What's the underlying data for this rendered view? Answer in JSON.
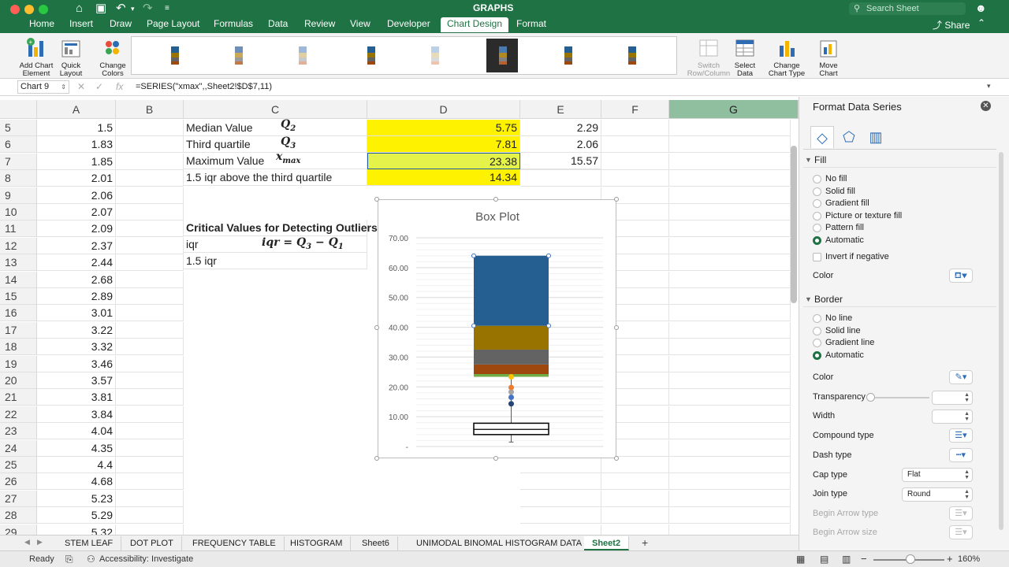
{
  "window": {
    "title": "GRAPHS",
    "search_placeholder": "Search Sheet",
    "share_label": "Share",
    "ribbon_tabs": [
      {
        "label": "Home"
      },
      {
        "label": "Insert"
      },
      {
        "label": "Draw"
      },
      {
        "label": "Page Layout"
      },
      {
        "label": "Formulas"
      },
      {
        "label": "Data"
      },
      {
        "label": "Review"
      },
      {
        "label": "View"
      },
      {
        "label": "Developer"
      },
      {
        "label": "Chart Design"
      },
      {
        "label": "Format"
      }
    ],
    "active_tab": "Chart Design"
  },
  "ribbon": {
    "add_chart_element": "Add Chart Element",
    "quick_layout": "Quick Layout",
    "change_colors": "Change Colors",
    "switch_row_column": "Switch Row/Column",
    "select_data": "Select Data",
    "change_chart_type": "Change Chart Type",
    "move_chart": "Move Chart"
  },
  "formula_bar": {
    "name_box": "Chart 9",
    "fx": "fx",
    "formula": "=SERIES(\"xmax\",,Sheet2!$D$7,11)"
  },
  "columns": [
    "A",
    "B",
    "C",
    "D",
    "E",
    "F",
    "G"
  ],
  "rows": [
    {
      "n": "5",
      "a": "1.5"
    },
    {
      "n": "6",
      "a": "1.83"
    },
    {
      "n": "7",
      "a": "1.85"
    },
    {
      "n": "8",
      "a": "2.01"
    },
    {
      "n": "9",
      "a": "2.06"
    },
    {
      "n": "10",
      "a": "2.07"
    },
    {
      "n": "11",
      "a": "2.09"
    },
    {
      "n": "12",
      "a": "2.37"
    },
    {
      "n": "13",
      "a": "2.44"
    },
    {
      "n": "14",
      "a": "2.68"
    },
    {
      "n": "15",
      "a": "2.89"
    },
    {
      "n": "16",
      "a": "3.01"
    },
    {
      "n": "17",
      "a": "3.22"
    },
    {
      "n": "18",
      "a": "3.32"
    },
    {
      "n": "19",
      "a": "3.46"
    },
    {
      "n": "20",
      "a": "3.57"
    },
    {
      "n": "21",
      "a": "3.81"
    },
    {
      "n": "22",
      "a": "3.84"
    },
    {
      "n": "23",
      "a": "4.04"
    },
    {
      "n": "24",
      "a": "4.35"
    },
    {
      "n": "25",
      "a": "4.4"
    },
    {
      "n": "26",
      "a": "4.68"
    },
    {
      "n": "27",
      "a": "5.23"
    },
    {
      "n": "28",
      "a": "5.29"
    },
    {
      "n": "29",
      "a": "5.32"
    }
  ],
  "cells": {
    "c5": "Median Value",
    "d5": "5.75",
    "e5": "2.29",
    "c6": "Third quartile",
    "d6": "7.81",
    "e6": "2.06",
    "c7": "Maximum Value",
    "d7": "23.38",
    "e7": "15.57",
    "c8": "1.5 iqr above the third quartile",
    "d8": "14.34",
    "c11": "Critical Values for Detecting Outliers",
    "c12": "iqr",
    "c13": "1.5 iqr"
  },
  "math": {
    "q2": "Q",
    "q2_sub": "2",
    "q3": "Q",
    "q3_sub": "3",
    "xmax": "x",
    "xmax_sub": "max",
    "iqr_formula": "iqr = Q",
    "iqr_sub3": "3",
    "iqr_minus": " − Q",
    "iqr_sub1": "1"
  },
  "chart_data": {
    "type": "bar",
    "title": "Box Plot",
    "ylim": [
      0,
      70
    ],
    "yticks": [
      "70.00",
      "60.00",
      "50.00",
      "40.00",
      "30.00",
      "20.00",
      "10.00",
      "-"
    ],
    "stacked_segments": [
      {
        "from": 23.38,
        "to": 24.3,
        "color": "#70ad47"
      },
      {
        "from": 24.3,
        "to": 27.5,
        "color": "#9e480e"
      },
      {
        "from": 27.5,
        "to": 32.5,
        "color": "#636363"
      },
      {
        "from": 32.5,
        "to": 40.5,
        "color": "#997300"
      },
      {
        "from": 40.5,
        "to": 64.0,
        "color": "#255e91"
      }
    ],
    "box": {
      "q1": 4.0,
      "q3": 7.81,
      "whisker_low": 1.5
    },
    "points": [
      {
        "y": 14.34,
        "color": "#264478"
      },
      {
        "y": 16.5,
        "color": "#4472c4"
      },
      {
        "y": 18.3,
        "color": "#a5a5a5"
      },
      {
        "y": 19.8,
        "color": "#ed7d31"
      },
      {
        "y": 23.38,
        "color": "#ffc000"
      }
    ]
  },
  "sheet_tabs": [
    {
      "label": "STEM LEAF"
    },
    {
      "label": "DOT PLOT"
    },
    {
      "label": "FREQUENCY TABLE"
    },
    {
      "label": "HISTOGRAM"
    },
    {
      "label": "Sheet6"
    },
    {
      "label": "UNIMODAL BINOMAL HISTOGRAM DATA"
    },
    {
      "label": "Sheet2"
    }
  ],
  "active_sheet": "Sheet2",
  "status": {
    "ready": "Ready",
    "accessibility": "Accessibility: Investigate",
    "zoom": "160%"
  },
  "pane": {
    "title": "Format Data Series",
    "fill_header": "Fill",
    "fill_options": [
      {
        "label": "No fill",
        "on": false
      },
      {
        "label": "Solid fill",
        "on": false
      },
      {
        "label": "Gradient fill",
        "on": false
      },
      {
        "label": "Picture or texture fill",
        "on": false
      },
      {
        "label": "Pattern fill",
        "on": false
      },
      {
        "label": "Automatic",
        "on": true
      }
    ],
    "invert_if_negative": "Invert if negative",
    "color_label": "Color",
    "border_header": "Border",
    "border_options": [
      {
        "label": "No line",
        "on": false
      },
      {
        "label": "Solid line",
        "on": false
      },
      {
        "label": "Gradient line",
        "on": false
      },
      {
        "label": "Automatic",
        "on": true
      }
    ],
    "border_color_label": "Color",
    "transparency_label": "Transparency",
    "width_label": "Width",
    "compound_label": "Compound type",
    "dash_label": "Dash type",
    "cap_label": "Cap type",
    "cap_value": "Flat",
    "join_label": "Join type",
    "join_value": "Round",
    "begin_arrow_type": "Begin Arrow type",
    "begin_arrow_size": "Begin Arrow size",
    "accent": "#1f7244"
  }
}
